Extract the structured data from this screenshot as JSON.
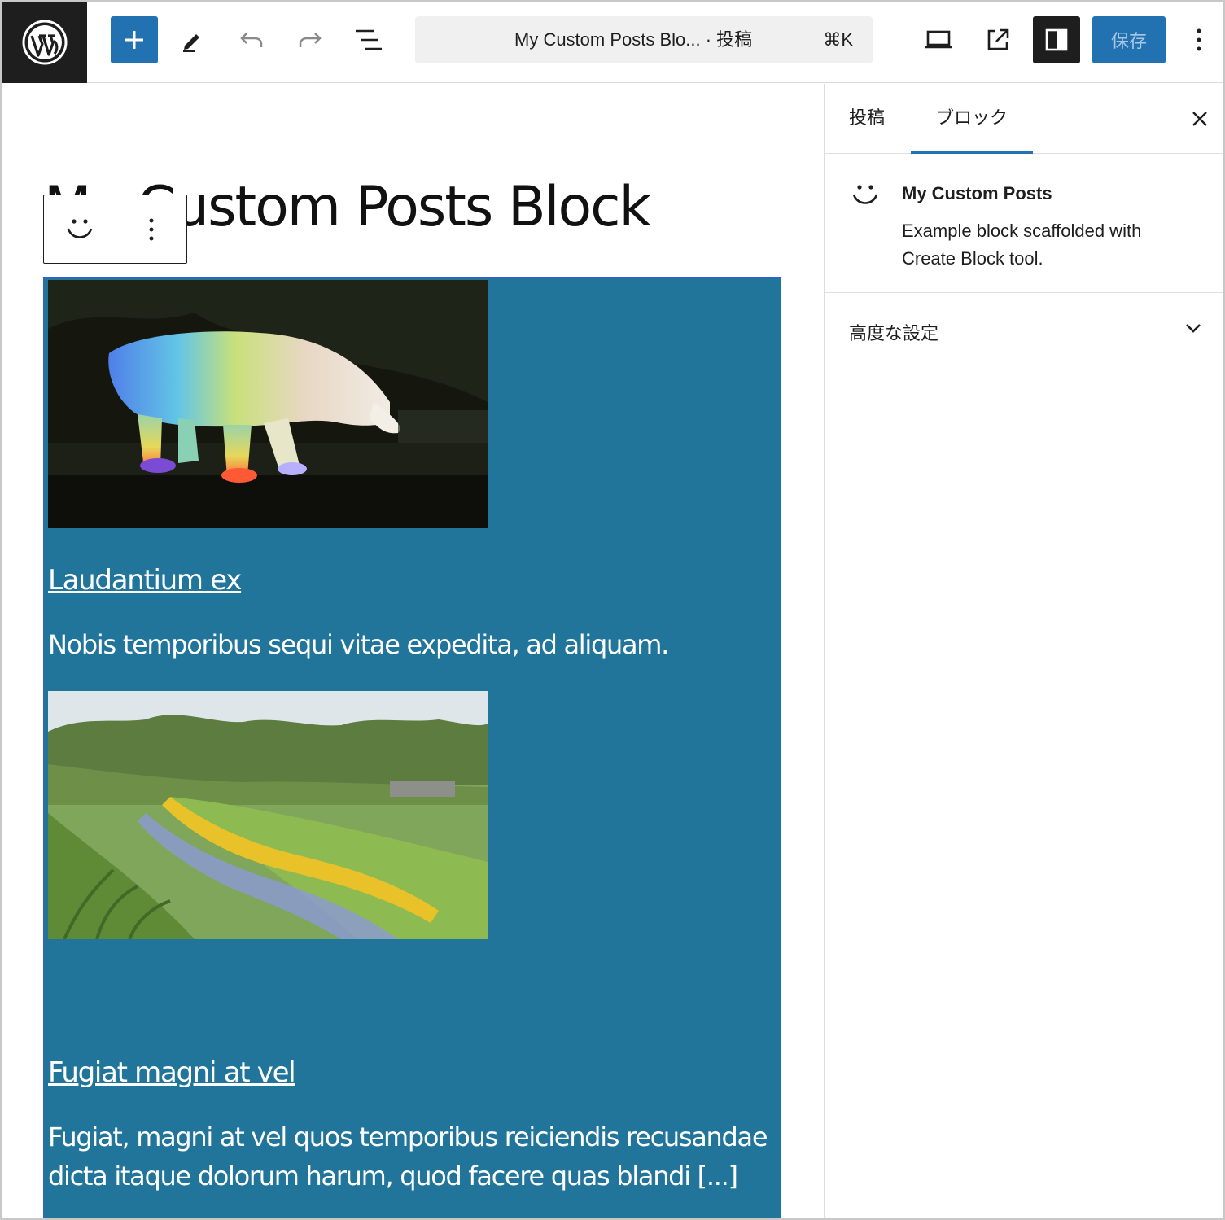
{
  "header": {
    "document_title": "My Custom Posts Blo... · 投稿",
    "shortcut": "⌘K",
    "save_label": "保存"
  },
  "editor": {
    "post_title": "My Custom Posts Block",
    "posts": [
      {
        "title": "Laudantium ex",
        "excerpt": "Nobis temporibus sequi vitae expedita, ad aliquam."
      },
      {
        "title": "Fugiat magni at vel",
        "excerpt": "Fugiat, magni at vel quos temporibus reiciendis recusandae dicta itaque dolorum harum, quod facere quas blandi [...]"
      }
    ]
  },
  "sidebar": {
    "tabs": [
      "投稿",
      "ブロック"
    ],
    "active_tab": "ブロック",
    "block_title": "My Custom Posts",
    "block_description": "Example block scaffolded with Create Block tool.",
    "advanced_label": "高度な設定"
  },
  "colors": {
    "accent": "#2271b1",
    "block_background": "#21759b",
    "dark": "#1e1e1e"
  }
}
